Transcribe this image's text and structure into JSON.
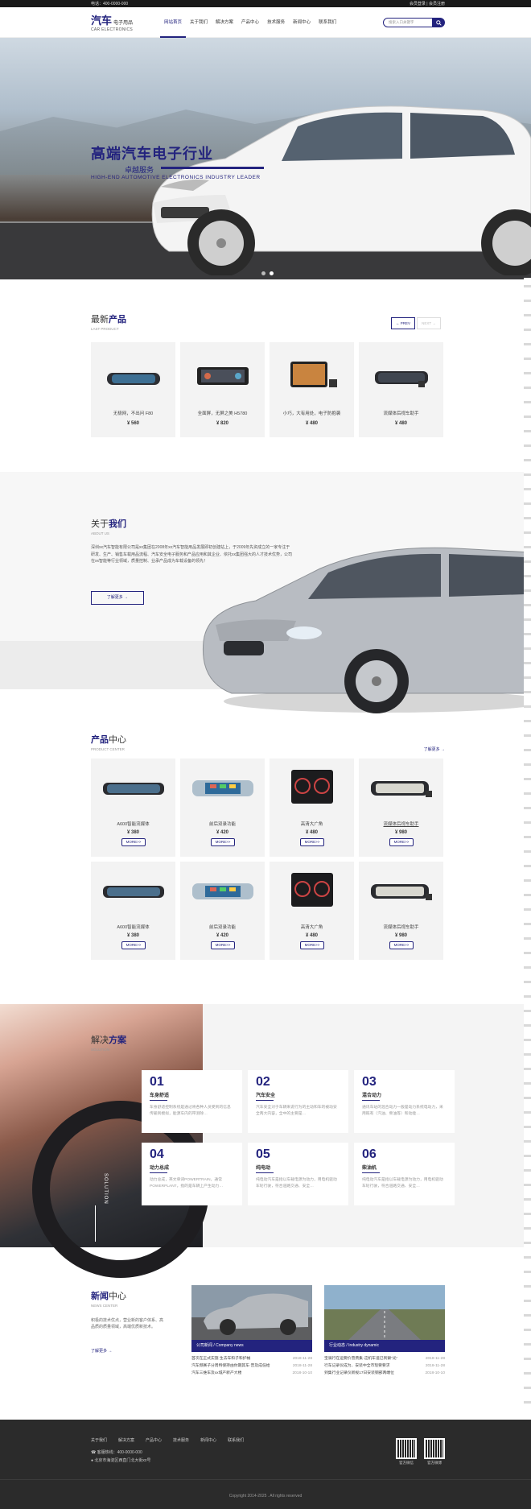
{
  "topbar": {
    "phone": "电话：400-0000-000",
    "auth": "会员登录 | 会员注册"
  },
  "logo": {
    "cn": "汽车",
    "cn_small": "电子用品",
    "en": "CAR ELECTRONICS"
  },
  "nav": [
    "网站首页",
    "关于我们",
    "解决方案",
    "产品中心",
    "技术服务",
    "新闻中心",
    "联系我们"
  ],
  "search": {
    "placeholder": "搜索入口关键字"
  },
  "hero": {
    "title": "高端汽车电子行业",
    "sub": "卓越服务",
    "en": "HIGH-END AUTOMOTIVE ELECTRONICS INDUSTRY LEADER"
  },
  "newp": {
    "t1": "最新",
    "t2": "产品",
    "en": "LAST PRODUCT",
    "prev": "← PREV",
    "next": "NEXT →",
    "items": [
      {
        "name": "无极网，不出问 F80",
        "price": "¥ 560"
      },
      {
        "name": "全面屏，无屏之美 H5780",
        "price": "¥ 820"
      },
      {
        "name": "小巧，大有用处，电子防抱袭",
        "price": "¥ 480"
      },
      {
        "name": "流媒体后视车助手",
        "price": "¥ 480"
      }
    ]
  },
  "about": {
    "t1": "关于",
    "t2": "我们",
    "en": "ABOUT US",
    "text": "深圳xx汽车智能有限公司是xx集团在2008年xx汽车智能用品发展即初创建站上，于2009年先资成立的一家专注于研发、生产、销售车载用品流程、汽车安全电子服务和产品应用和其企业、依托xx集团强大的人才技术优势，公司在xx智能等行业领域，质量控制、业承产品成为车载设备的领先！",
    "more": "了解更多 →"
  },
  "pc": {
    "t1": "产品",
    "t2": "中心",
    "en": "PRODUCT CENTER",
    "more": "了解更多 →",
    "mb": "MORE>>",
    "items": [
      {
        "name": "A600智能流媒体",
        "price": "¥ 380"
      },
      {
        "name": "前后双录功能",
        "price": "¥ 420"
      },
      {
        "name": "高清大广角",
        "price": "¥ 480"
      },
      {
        "name": "流媒体后视车助手",
        "price": "¥ 980"
      },
      {
        "name": "A600智能流媒体",
        "price": "¥ 380"
      },
      {
        "name": "前后双录功能",
        "price": "¥ 420"
      },
      {
        "name": "高清大广角",
        "price": "¥ 480"
      },
      {
        "name": "流媒体后视车助手",
        "price": "¥ 980"
      }
    ]
  },
  "sol": {
    "t1": "解决",
    "t2": "方案",
    "en": "SOLUTION",
    "vt": "SOLUTION",
    "items": [
      {
        "n": "01",
        "h": "车身舒适",
        "d": "车身舒适控制系统是通过将各种人员受到的信息传输到模拟，能源车内的带测除…"
      },
      {
        "n": "02",
        "h": "汽车安全",
        "d": "汽车安全对于车辆来说行为的主动和车的被动安全两大内容，全中的主要是…"
      },
      {
        "n": "03",
        "h": "混合动力",
        "d": "通讯车站的混合动力一般是动力系统电动力，采用既有（汽油、柴油等）和动能…"
      },
      {
        "n": "04",
        "h": "动力总成",
        "d": "动力总成，英文单词POWERTRAIN，通常POWERPLANT，指的是车辆上产生动力…"
      },
      {
        "n": "05",
        "h": "纯电动",
        "d": "纯电动汽车是指以车载电源为动力，用电机驱动车轮行驶，符合道路交通、安全…"
      },
      {
        "n": "06",
        "h": "柴油机",
        "d": "纯电动汽车是指以车载电源为动力，用电机驱动车轮行驶，符合道路交通、安全…"
      }
    ]
  },
  "news": {
    "t1": "新闻",
    "t2": "中心",
    "en": "NEWS CENTER",
    "text": "积极的技术优点，营业新的客户体系、高品质的质量领域，高端优质新技术。",
    "more": "了解更多 →",
    "c1": {
      "bar": "公司新闻 / Company news",
      "items": [
        {
          "t": "首次在正式实施 生去车和子和护械",
          "d": "2018-11-28"
        },
        {
          "t": "汽车频赛子分周特保持由你期其车·普及成低给",
          "d": "2018-11-28"
        },
        {
          "t": "汽车三维车及xx城产新产大楼",
          "d": "2018-10-10"
        }
      ]
    },
    "c2": {
      "bar": "行业动态 / Industry dynamic",
      "items": [
        {
          "t": "宝骑行在运要价营费集·这机车道已到察“光”",
          "d": "2018-11-28"
        },
        {
          "t": "行车记录仪成为、安装中全市现要要求",
          "d": "2018-11-28"
        },
        {
          "t": "到集行业记录仪新规17日安装钢部两端位",
          "d": "2018-10-10"
        }
      ]
    }
  },
  "footer": {
    "nav": [
      "关于我们",
      "解决方案",
      "产品中心",
      "技术服务",
      "新闻中心",
      "联系我们"
    ],
    "hotline": "客服热线：400-0000-000",
    "addr": "北京市海淀区西直门北大街xx号",
    "qr1": "官方微信",
    "qr2": "官方微博",
    "copy": "Copyright 2014-2025 . All rights reserved"
  }
}
